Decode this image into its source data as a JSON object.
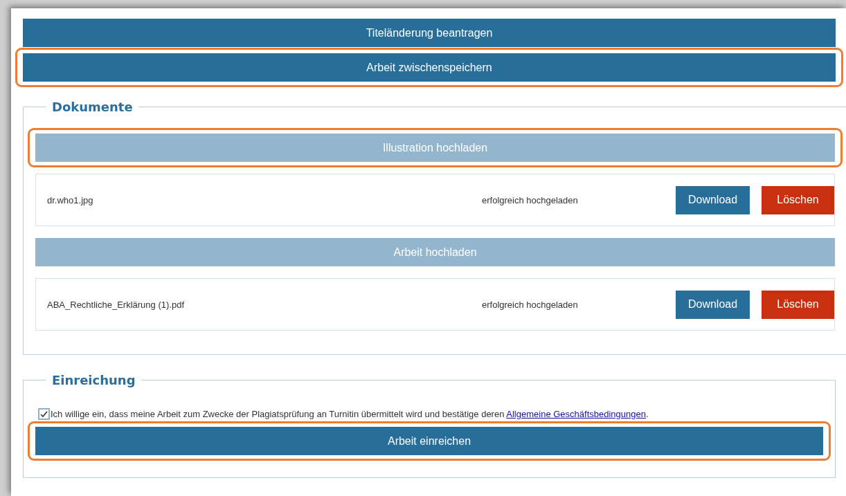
{
  "actions": [
    {
      "label": "Titeländerung beantragen",
      "highlighted": false
    },
    {
      "label": "Arbeit zwischenspeichern",
      "highlighted": true
    }
  ],
  "documents": {
    "legend": "Dokumente",
    "groups": [
      {
        "upload": {
          "label": "Illustration hochladen",
          "highlighted": true
        },
        "files": [
          {
            "name": "dr.who1.jpg",
            "status": "erfolgreich hochgeladen",
            "download": "Download",
            "delete": "Löschen"
          }
        ]
      },
      {
        "upload": {
          "label": "Arbeit hochladen",
          "highlighted": false
        },
        "files": [
          {
            "name": "ABA_Rechtliche_Erklärung (1).pdf",
            "status": "erfolgreich hochgeladen",
            "download": "Download",
            "delete": "Löschen"
          }
        ]
      }
    ]
  },
  "submission": {
    "legend": "Einreichung",
    "consent": {
      "checked": true,
      "text": "Ich willige ein, dass meine Arbeit zum Zwecke der Plagiatsprüfung an Turnitin übermittelt wird und bestätige deren",
      "link": "Allgemeine Geschäftsbedingungen",
      "end": "."
    },
    "submit": {
      "label": "Arbeit einreichen",
      "highlighted": true
    }
  }
}
